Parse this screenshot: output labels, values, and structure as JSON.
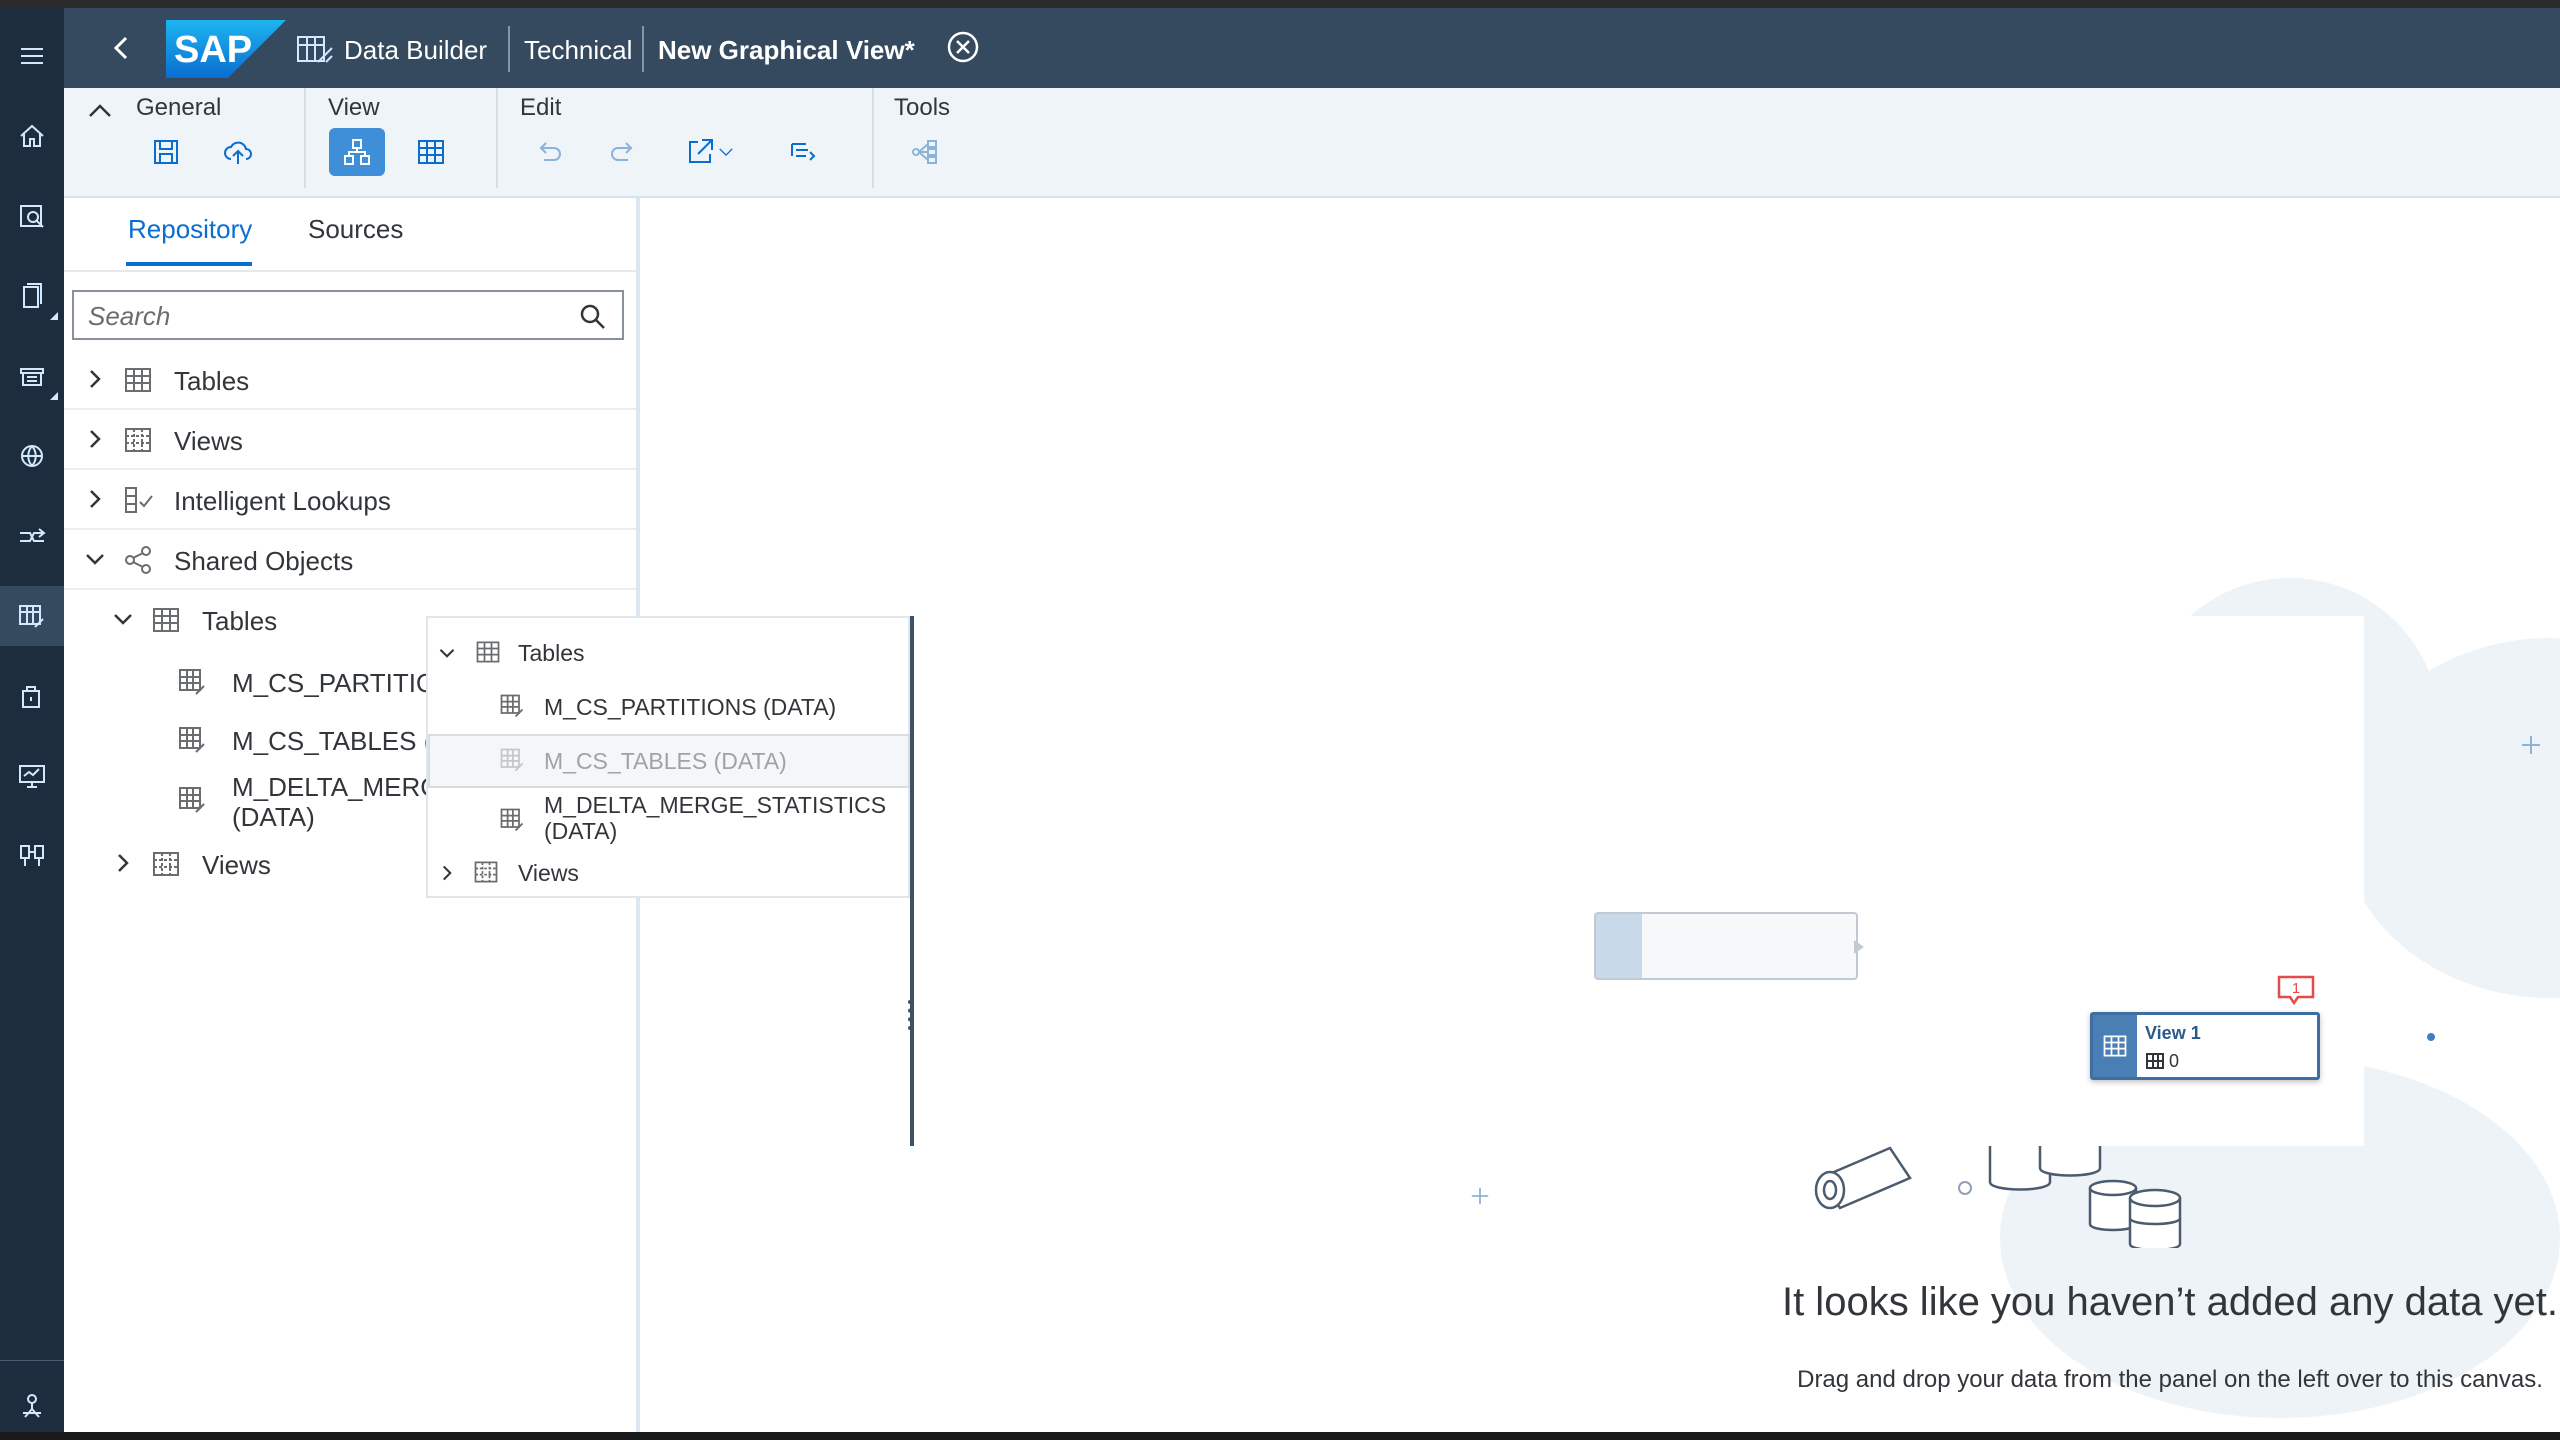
{
  "shell": {
    "app_name": "Data Builder",
    "space": "Technical",
    "document": "New Graphical View",
    "dirty_marker": "*"
  },
  "toolbar": {
    "groups": [
      "General",
      "View",
      "Edit",
      "Tools"
    ]
  },
  "left_panel": {
    "tabs": [
      "Repository",
      "Sources"
    ],
    "selected_tab": "Repository",
    "search_placeholder": "Search",
    "tree": [
      {
        "label": "Tables",
        "expanded": false
      },
      {
        "label": "Views",
        "expanded": false
      },
      {
        "label": "Intelligent Lookups",
        "expanded": false
      },
      {
        "label": "Shared Objects",
        "expanded": true
      }
    ],
    "shared": {
      "tables_label": "Tables",
      "items": [
        "M_CS_PARTITIO",
        "M_CS_TABLES (I",
        "M_DELTA_MERG",
        "(DATA)"
      ],
      "views_label": "Views"
    }
  },
  "popover": {
    "tables_label": "Tables",
    "items": [
      "M_CS_PARTITIONS (DATA)",
      "M_CS_TABLES (DATA)",
      "M_DELTA_MERGE_STATISTICS",
      "(DATA)"
    ],
    "views_label": "Views"
  },
  "canvas": {
    "node_name": "View 1",
    "node_count": "0",
    "badge_count": "1",
    "empty_title": "It looks like you haven’t added any data yet.",
    "empty_subtitle": "Drag and drop your data from the panel on the left over to this canvas."
  },
  "colors": {
    "shell": "#354a5f",
    "sidenav": "#1d2d3e",
    "accent": "#0a6ed1",
    "badge": "#e34c4c"
  }
}
